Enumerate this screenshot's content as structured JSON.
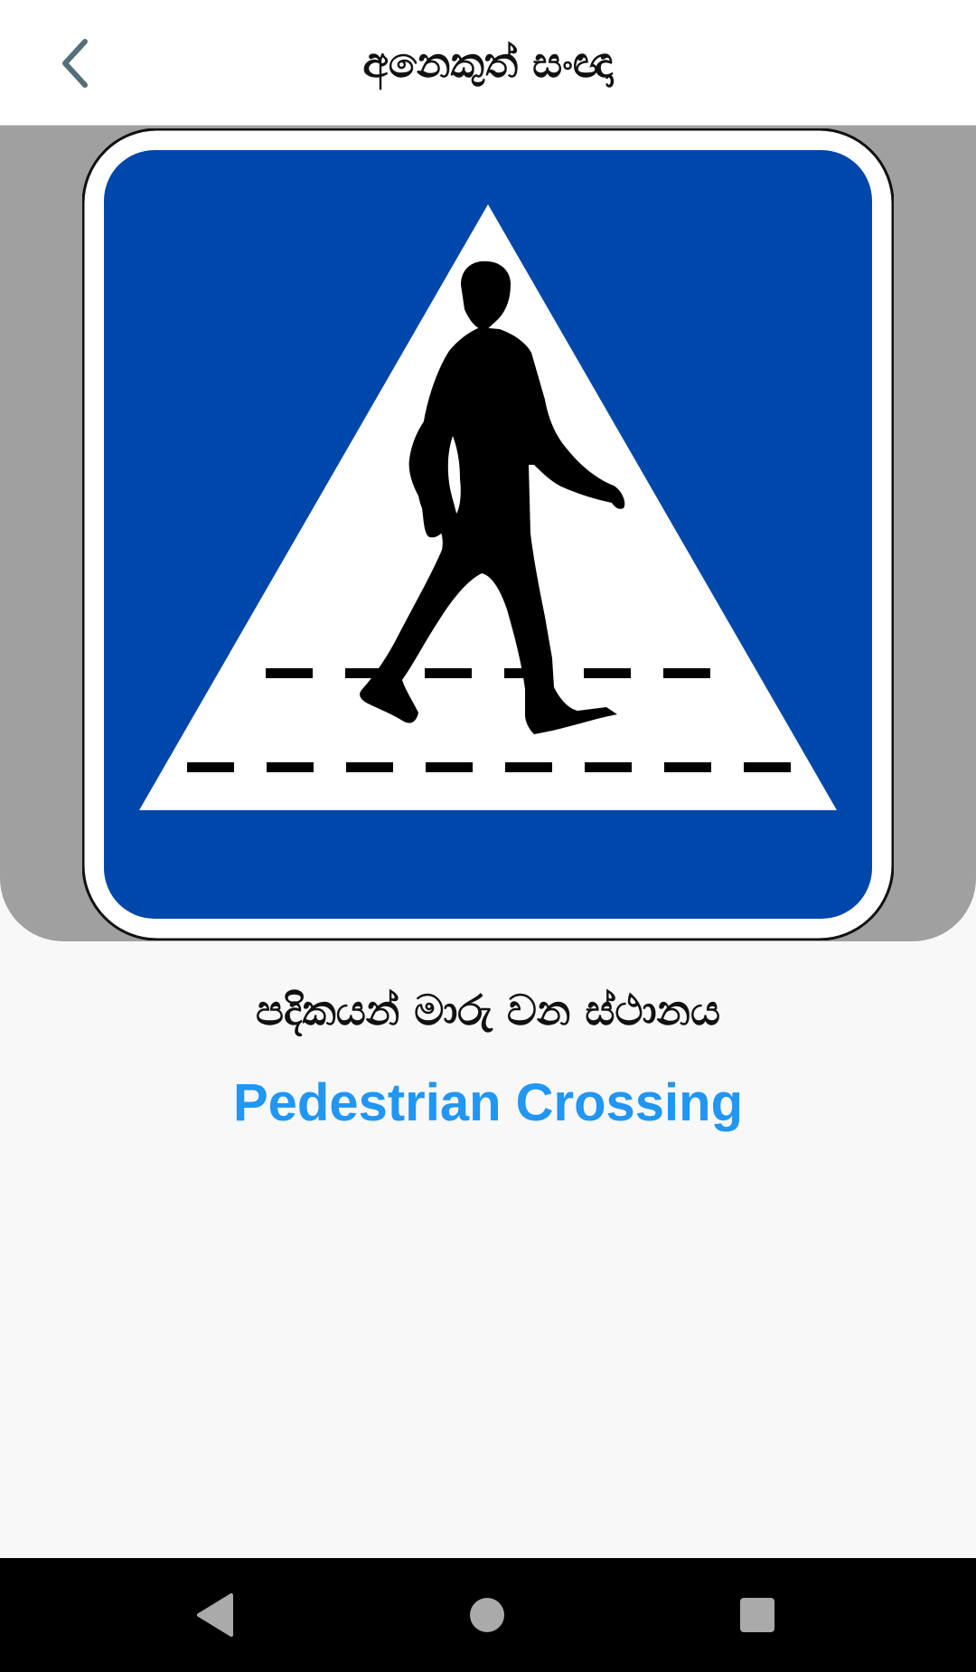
{
  "app_bar": {
    "title": "අනෙකුත් සංඥා",
    "back_icon": "chevron-left-icon",
    "back_icon_color": "#546e7a"
  },
  "sign": {
    "name_sinhala": "පදිකයන් මාරු වන ස්ථානය",
    "name_english": "Pedestrian Crossing",
    "english_color": "#2196f3",
    "sign_blue": "#0047ab",
    "panel_color": "#a0a0a0"
  },
  "nav_bar": {
    "back_icon": "triangle-back-icon",
    "home_icon": "circle-home-icon",
    "recents_icon": "square-recents-icon"
  }
}
